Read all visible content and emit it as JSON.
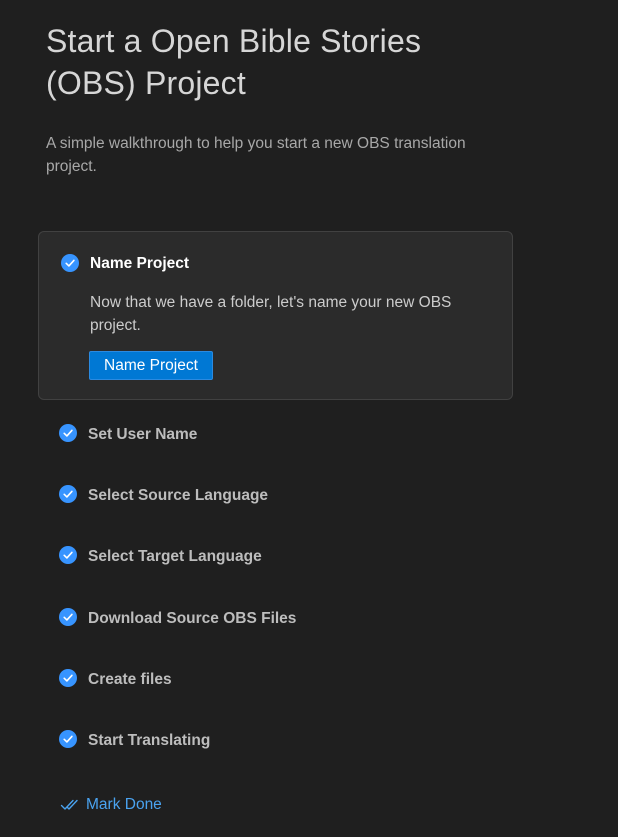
{
  "header": {
    "title": "Start a Open Bible Stories (OBS) Project",
    "description": "A simple walkthrough to help you start a new OBS translation project."
  },
  "active_step": {
    "title": "Name Project",
    "description": "Now that we have a folder, let's name your new OBS project.",
    "button_label": "Name Project",
    "completed": true
  },
  "steps": [
    {
      "label": "Set User Name",
      "completed": true
    },
    {
      "label": "Select Source Language",
      "completed": true
    },
    {
      "label": "Select Target Language",
      "completed": true
    },
    {
      "label": "Download Source OBS Files",
      "completed": true
    },
    {
      "label": "Create files",
      "completed": true
    },
    {
      "label": "Start Translating",
      "completed": true
    }
  ],
  "footer": {
    "mark_done_label": "Mark Done",
    "mark_done_icon": "double-check-icon"
  },
  "colors": {
    "background": "#1f1f1f",
    "accent": "#3794ff",
    "button": "#0078d4",
    "link": "#4aa3f0"
  }
}
